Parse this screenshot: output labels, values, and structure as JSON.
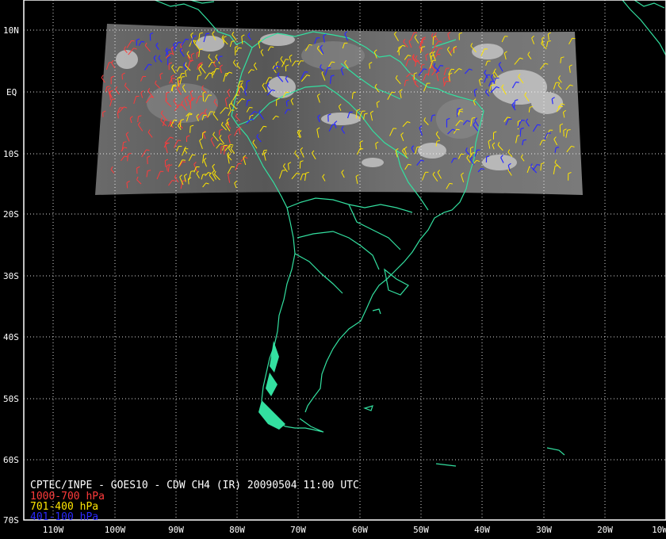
{
  "title": "CPTEC/INPE - GOES10 - CDW CH4 (IR) 20090504 11:00 UTC",
  "legend": [
    {
      "label": "1000-700 hPa",
      "color": "#ff3b3b"
    },
    {
      "label": "701-400 hPa",
      "color": "#ffe600"
    },
    {
      "label": "401-100 hPa",
      "color": "#2a2aff"
    }
  ],
  "lat_labels": [
    "10N",
    "EQ",
    "10S",
    "20S",
    "30S",
    "40S",
    "50S",
    "60S",
    "70S"
  ],
  "lon_labels": [
    "110W",
    "100W",
    "90W",
    "80W",
    "70W",
    "60W",
    "50W",
    "40W",
    "30W",
    "20W",
    "10W"
  ],
  "colors": {
    "background": "#000000",
    "coastline": "#33e0a0",
    "grid": "#ffffff",
    "frame": "#ffffff"
  }
}
